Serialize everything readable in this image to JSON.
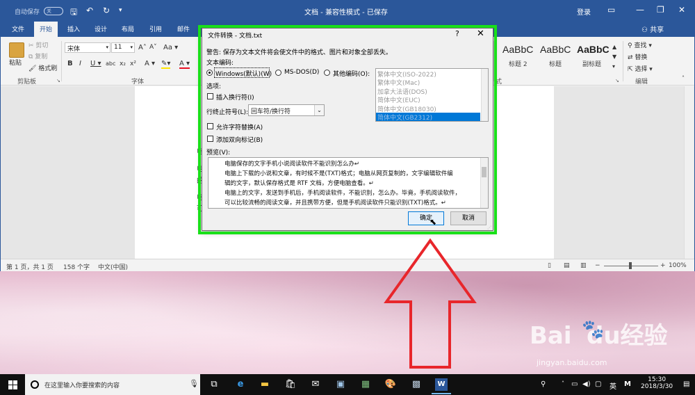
{
  "word": {
    "autosave_label": "自动保存",
    "autosave_toggle": "关",
    "doc_title": "文档 - 兼容性模式 - 已保存",
    "login": "登录",
    "share": "共享",
    "tabs": [
      "文件",
      "开始",
      "插入",
      "设计",
      "布局",
      "引用",
      "邮件"
    ],
    "ribbon": {
      "paste": "粘贴",
      "cut": "剪切",
      "copy": "复制",
      "format_painter": "格式刷",
      "clipboard_group": "剪贴板",
      "font_name": "宋体",
      "font_size": "11",
      "font_group": "字体",
      "styles": [
        {
          "sample": "AaBbC",
          "name": ""
        },
        {
          "sample": "AaBbC",
          "name": "标题 2"
        },
        {
          "sample": "AaBbC",
          "name": "标题"
        },
        {
          "sample": "AaBbC",
          "name": "副标题"
        }
      ],
      "style_group_suffix": "式",
      "find": "查找",
      "replace": "替换",
      "select": "选择",
      "edit_group": "编辑"
    },
    "status": {
      "page": "第 1 页，共 1 页",
      "words": "158 个字",
      "lang": "中文(中国)",
      "zoom": "100%"
    }
  },
  "dialog": {
    "title": "文件转换 - 文档.txt",
    "help": "?",
    "warning": "警告: 保存为文本文件将会使文件中的格式、图片和对象全部丢失。",
    "encoding_label": "文本编码:",
    "enc_windows": "Windows(默认)(W)",
    "enc_msdos": "MS-DOS(D)",
    "enc_other": "其他编码(O):",
    "encoding_list": [
      "繁体中文(ISO-2022)",
      "繁体中文(Mac)",
      "加拿大法语(DOS)",
      "简体中文(EUC)",
      "简体中文(GB18030)",
      "简体中文(GB2312)"
    ],
    "options_label": "选项:",
    "insert_breaks": "插入换行符(I)",
    "line_end_label": "行终止符号(L):",
    "line_end_value": "回车符/换行符",
    "allow_sub": "允许字符替换(A)",
    "add_bidi": "添加双向标记(B)",
    "preview_label": "预览(V):",
    "preview_lines": [
      "电脑保存的文字手机小说阅读软件不能识别怎么办↵",
      "电脑上下载的小说和文章，有时候不是(TXT)格式；电脑从网页复制的，文字编辑软件编",
      "辑的文字，默认保存格式是 RTF 文档，方便电脑查看。↵",
      "电脑上的文字，发送到手机后，手机阅读软件，不能识别，怎么办。毕竟，手机阅读软件，",
      "可以比较流畅的阅读文章，并且携带方便，但是手机阅读软件只能识别(TXT)格式。↵"
    ],
    "ok": "确定",
    "cancel": "取消"
  },
  "watermark": {
    "logo": "Baidu经验",
    "url": "jingyan.baidu.com"
  },
  "taskbar": {
    "search_placeholder": "在这里输入你要搜索的内容",
    "ime": "英",
    "ime2": "M",
    "time": "15:30",
    "date": "2018/3/30"
  },
  "colors": {
    "word_blue": "#2b579a",
    "highlight_green": "#19e019",
    "arrow_red": "#e8262b"
  }
}
